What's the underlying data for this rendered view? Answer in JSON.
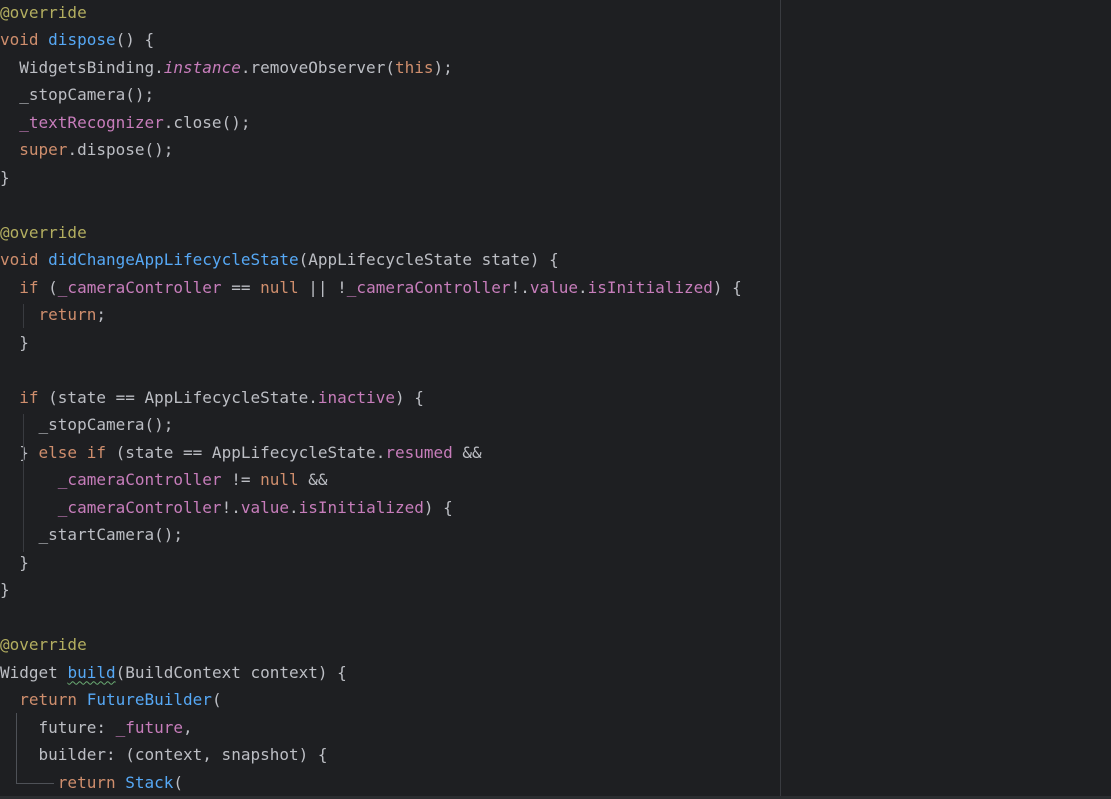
{
  "editor": {
    "colors": {
      "background": "#1e1f22",
      "default_text": "#bcbec4",
      "keyword": "#cf8e6d",
      "function": "#56a8f5",
      "annotation": "#b3ae60",
      "field": "#c77dbb"
    },
    "lines": [
      [
        {
          "t": "@override",
          "c": "ann"
        }
      ],
      [
        {
          "t": "void ",
          "c": "kw"
        },
        {
          "t": "dispose",
          "c": "fn"
        },
        {
          "t": "() {",
          "c": "pl"
        }
      ],
      [
        {
          "t": "  WidgetsBinding.",
          "c": "pl"
        },
        {
          "t": "instance",
          "c": "sprop"
        },
        {
          "t": ".removeObserver(",
          "c": "pl"
        },
        {
          "t": "this",
          "c": "kw"
        },
        {
          "t": ");",
          "c": "pl"
        }
      ],
      [
        {
          "t": "  _stopCamera();",
          "c": "pl"
        }
      ],
      [
        {
          "t": "  ",
          "c": "pl"
        },
        {
          "t": "_textRecognizer",
          "c": "fld"
        },
        {
          "t": ".close();",
          "c": "pl"
        }
      ],
      [
        {
          "t": "  ",
          "c": "pl"
        },
        {
          "t": "super",
          "c": "kw"
        },
        {
          "t": ".dispose();",
          "c": "pl"
        }
      ],
      [
        {
          "t": "}",
          "c": "pl"
        }
      ],
      [],
      [
        {
          "t": "@override",
          "c": "ann"
        }
      ],
      [
        {
          "t": "void ",
          "c": "kw"
        },
        {
          "t": "didChangeAppLifecycleState",
          "c": "fn"
        },
        {
          "t": "(AppLifecycleState state) {",
          "c": "pl"
        }
      ],
      [
        {
          "t": "  ",
          "c": "pl"
        },
        {
          "t": "if",
          "c": "kw"
        },
        {
          "t": " (",
          "c": "pl"
        },
        {
          "t": "_cameraController",
          "c": "fld"
        },
        {
          "t": " == ",
          "c": "pl"
        },
        {
          "t": "null",
          "c": "kw"
        },
        {
          "t": " || !",
          "c": "pl"
        },
        {
          "t": "_cameraController",
          "c": "fld"
        },
        {
          "t": "!.",
          "c": "pl"
        },
        {
          "t": "value",
          "c": "prop"
        },
        {
          "t": ".",
          "c": "pl"
        },
        {
          "t": "isInitialized",
          "c": "prop"
        },
        {
          "t": ") {",
          "c": "pl"
        }
      ],
      [
        {
          "t": "    ",
          "c": "pl"
        },
        {
          "t": "return",
          "c": "kw"
        },
        {
          "t": ";",
          "c": "pl"
        }
      ],
      [
        {
          "t": "  }",
          "c": "pl"
        }
      ],
      [],
      [
        {
          "t": "  ",
          "c": "pl"
        },
        {
          "t": "if",
          "c": "kw"
        },
        {
          "t": " (state == AppLifecycleState.",
          "c": "pl"
        },
        {
          "t": "inactive",
          "c": "prop"
        },
        {
          "t": ") {",
          "c": "pl"
        }
      ],
      [
        {
          "t": "    _stopCamera();",
          "c": "pl"
        }
      ],
      [
        {
          "t": "  } ",
          "c": "pl"
        },
        {
          "t": "else if",
          "c": "kw"
        },
        {
          "t": " (state == AppLifecycleState.",
          "c": "pl"
        },
        {
          "t": "resumed",
          "c": "prop"
        },
        {
          "t": " &&",
          "c": "pl"
        }
      ],
      [
        {
          "t": "      ",
          "c": "pl"
        },
        {
          "t": "_cameraController",
          "c": "fld"
        },
        {
          "t": " != ",
          "c": "pl"
        },
        {
          "t": "null",
          "c": "kw"
        },
        {
          "t": " &&",
          "c": "pl"
        }
      ],
      [
        {
          "t": "      ",
          "c": "pl"
        },
        {
          "t": "_cameraController",
          "c": "fld"
        },
        {
          "t": "!.",
          "c": "pl"
        },
        {
          "t": "value",
          "c": "prop"
        },
        {
          "t": ".",
          "c": "pl"
        },
        {
          "t": "isInitialized",
          "c": "prop"
        },
        {
          "t": ") {",
          "c": "pl"
        }
      ],
      [
        {
          "t": "    _startCamera();",
          "c": "pl"
        }
      ],
      [
        {
          "t": "  }",
          "c": "pl"
        }
      ],
      [
        {
          "t": "}",
          "c": "pl"
        }
      ],
      [],
      [
        {
          "t": "@override",
          "c": "ann"
        }
      ],
      [
        {
          "t": "Widget ",
          "c": "pl"
        },
        {
          "t": "build",
          "c": "fn typo"
        },
        {
          "t": "(BuildContext context) {",
          "c": "pl"
        }
      ],
      [
        {
          "t": "  ",
          "c": "pl"
        },
        {
          "t": "return",
          "c": "kw"
        },
        {
          "t": " ",
          "c": "pl"
        },
        {
          "t": "FutureBuilder",
          "c": "fn"
        },
        {
          "t": "(",
          "c": "pl"
        }
      ],
      [
        {
          "t": "    future: ",
          "c": "pl"
        },
        {
          "t": "_future",
          "c": "fld"
        },
        {
          "t": ",",
          "c": "pl"
        }
      ],
      [
        {
          "t": "    builder: (context, snapshot) {",
          "c": "pl"
        }
      ],
      [
        {
          "t": "      ",
          "c": "pl"
        },
        {
          "t": "return",
          "c": "kw"
        },
        {
          "t": " ",
          "c": "pl"
        },
        {
          "t": "Stack",
          "c": "fn"
        },
        {
          "t": "(",
          "c": "pl"
        }
      ]
    ]
  }
}
